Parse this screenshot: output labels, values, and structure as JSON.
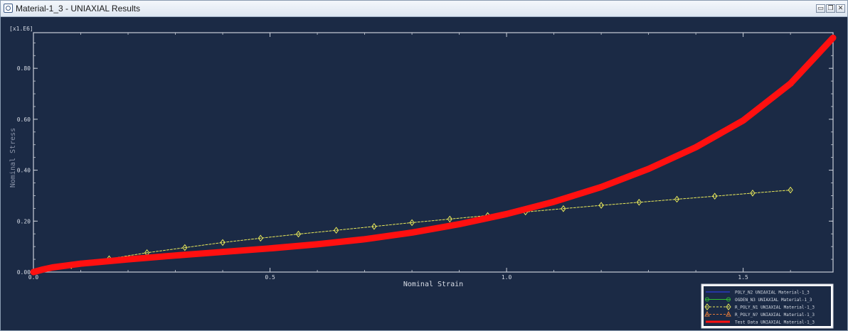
{
  "window": {
    "title": "Material-1_3 - UNIAXIAL Results",
    "buttons": {
      "minimize": "▭",
      "restore": "❐",
      "close": "✕"
    }
  },
  "chart_data": {
    "type": "line",
    "xlabel": "Nominal Strain",
    "ylabel": "Nominal Stress",
    "y_multiplier_label": "[x1.E6]",
    "xlim": [
      0,
      1.69
    ],
    "ylim": [
      0,
      0.94
    ],
    "x_ticks": [
      0.0,
      0.5,
      1.0,
      1.5
    ],
    "x_tick_labels": [
      "0.0",
      "0.5",
      "1.0",
      "1.5"
    ],
    "y_ticks": [
      0.0,
      0.2,
      0.4,
      0.6,
      0.8
    ],
    "y_tick_labels": [
      "0.00",
      "0.20",
      "0.40",
      "0.60",
      "0.80"
    ],
    "legend_placement": "bottom-right",
    "series": [
      {
        "name": "POLY_N2 UNIAXIAL Material-1_3",
        "color": "#3040ff",
        "style": "solid",
        "marker": "none",
        "x": [
          0,
          0.04,
          0.1,
          0.2,
          0.3,
          0.4,
          0.5,
          0.6,
          0.7,
          0.8,
          0.9,
          1.0,
          1.1,
          1.2,
          1.3,
          1.4,
          1.5,
          1.6,
          1.69
        ],
        "y": [
          0,
          0.018,
          0.033,
          0.05,
          0.065,
          0.079,
          0.093,
          0.109,
          0.129,
          0.155,
          0.188,
          0.228,
          0.276,
          0.334,
          0.405,
          0.49,
          0.595,
          0.74,
          0.92
        ]
      },
      {
        "name": "OGDEN_N3 UNIAXIAL Material-1_3",
        "color": "#30c030",
        "style": "solid",
        "marker": "circle",
        "x": [
          0,
          0.04,
          0.1,
          0.2,
          0.3,
          0.4,
          0.5,
          0.6,
          0.7,
          0.8,
          0.9,
          1.0,
          1.1,
          1.2,
          1.3,
          1.4,
          1.5,
          1.6,
          1.69
        ],
        "y": [
          0,
          0.018,
          0.033,
          0.05,
          0.065,
          0.079,
          0.093,
          0.109,
          0.129,
          0.155,
          0.188,
          0.228,
          0.276,
          0.334,
          0.405,
          0.49,
          0.595,
          0.74,
          0.92
        ]
      },
      {
        "name": "R_POLY_N1 UNIAXIAL Material-1_3",
        "color": "#e8e85a",
        "style": "dashed",
        "marker": "diamond",
        "x": [
          0,
          0.08,
          0.16,
          0.24,
          0.32,
          0.4,
          0.48,
          0.56,
          0.64,
          0.72,
          0.8,
          0.88,
          0.96,
          1.04,
          1.12,
          1.2,
          1.28,
          1.36,
          1.44,
          1.52,
          1.6
        ],
        "y": [
          0,
          0.025,
          0.052,
          0.076,
          0.096,
          0.116,
          0.133,
          0.149,
          0.164,
          0.179,
          0.194,
          0.208,
          0.222,
          0.236,
          0.249,
          0.262,
          0.274,
          0.286,
          0.298,
          0.31,
          0.322
        ]
      },
      {
        "name": "R_POLY_N? UNIAXIAL Material-1_3",
        "color": "#e07a3a",
        "style": "dashed",
        "marker": "triangle",
        "x": [
          0,
          0.04,
          0.1,
          0.2,
          0.3,
          0.4,
          0.5,
          0.6,
          0.7,
          0.8,
          0.9,
          1.0,
          1.1,
          1.2,
          1.3,
          1.4,
          1.5,
          1.6,
          1.69
        ],
        "y": [
          0,
          0.018,
          0.033,
          0.05,
          0.065,
          0.079,
          0.093,
          0.109,
          0.129,
          0.155,
          0.188,
          0.228,
          0.276,
          0.334,
          0.405,
          0.49,
          0.595,
          0.74,
          0.92
        ]
      },
      {
        "name": "Test Data UNIAXIAL Material-1_3",
        "color": "#ff1010",
        "style": "thick",
        "marker": "none",
        "x": [
          0,
          0.02,
          0.04,
          0.1,
          0.2,
          0.3,
          0.4,
          0.5,
          0.6,
          0.7,
          0.8,
          0.9,
          1.0,
          1.1,
          1.2,
          1.3,
          1.4,
          1.5,
          1.6,
          1.69
        ],
        "y": [
          0,
          0.01,
          0.018,
          0.033,
          0.05,
          0.065,
          0.079,
          0.093,
          0.109,
          0.129,
          0.155,
          0.188,
          0.228,
          0.276,
          0.334,
          0.405,
          0.49,
          0.595,
          0.74,
          0.92
        ]
      }
    ]
  }
}
